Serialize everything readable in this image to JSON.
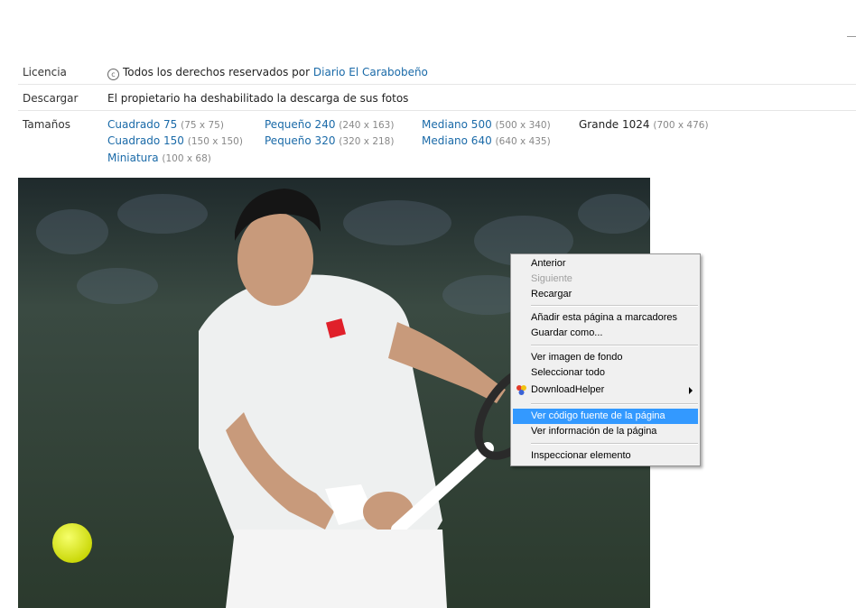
{
  "meta": {
    "license": {
      "label": "Licencia",
      "text": "Todos los derechos reservados por",
      "owner": "Diario El Carabobeño",
      "icon": "copyright-icon"
    },
    "download": {
      "label": "Descargar",
      "text": "El propietario ha deshabilitado la descarga de sus fotos"
    },
    "sizes": {
      "label": "Tamaños",
      "items": [
        {
          "name": "Cuadrado 75",
          "dim": "(75 x 75)"
        },
        {
          "name": "Cuadrado 150",
          "dim": "(150 x 150)"
        },
        {
          "name": "Miniatura",
          "dim": "(100 x 68)"
        },
        {
          "name": "Pequeño 240",
          "dim": "(240 x 163)"
        },
        {
          "name": "Pequeño 320",
          "dim": "(320 x 218)"
        },
        {
          "name": "Mediano 500",
          "dim": "(500 x 340)"
        },
        {
          "name": "Mediano 640",
          "dim": "(640 x 435)"
        },
        {
          "name": "Grande 1024",
          "dim": "(700 x 476)"
        }
      ]
    }
  },
  "context_menu": {
    "items": [
      {
        "label": "Anterior",
        "state": "enabled"
      },
      {
        "label": "Siguiente",
        "state": "disabled"
      },
      {
        "label": "Recargar",
        "state": "enabled"
      },
      {
        "label": "Añadir esta página a marcadores",
        "state": "enabled"
      },
      {
        "label": "Guardar como...",
        "state": "enabled"
      },
      {
        "label": "Ver imagen de fondo",
        "state": "enabled"
      },
      {
        "label": "Seleccionar todo",
        "state": "enabled"
      },
      {
        "label": "DownloadHelper",
        "state": "enabled",
        "icon": "downloadhelper-icon",
        "submenu": true
      },
      {
        "label": "Ver código fuente de la página",
        "state": "highlighted"
      },
      {
        "label": "Ver información de la página",
        "state": "enabled"
      },
      {
        "label": "Inspeccionar elemento",
        "state": "enabled"
      }
    ]
  },
  "colors": {
    "link": "#1a6aa8",
    "menu_highlight": "#3399ff"
  }
}
